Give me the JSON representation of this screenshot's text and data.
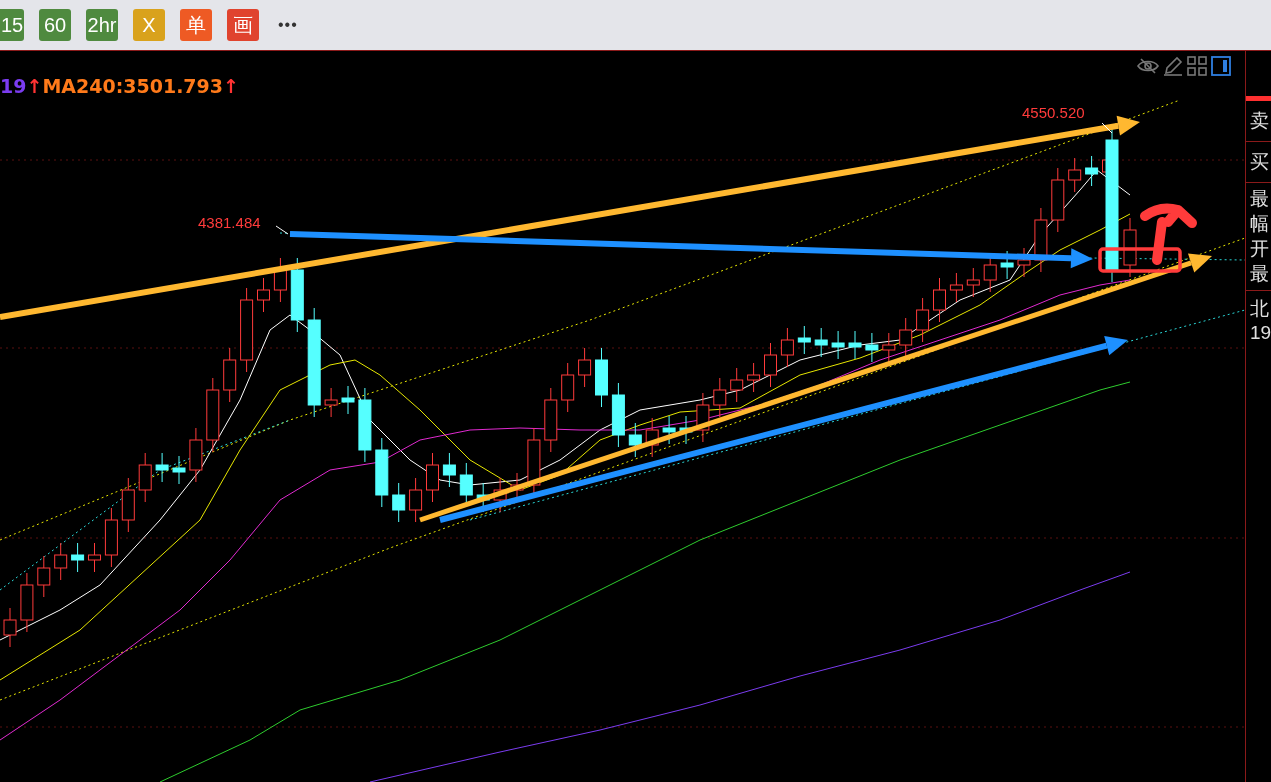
{
  "toolbar": {
    "buttons": [
      {
        "label": "15",
        "color": "#4f8a3f"
      },
      {
        "label": "60",
        "color": "#4f8a3f"
      },
      {
        "label": "2hr",
        "color": "#4f8a3f"
      },
      {
        "label": "X",
        "color": "#d9a21c"
      },
      {
        "label": "单",
        "color": "#ee5a24"
      },
      {
        "label": "画",
        "color": "#e0432e"
      }
    ],
    "more": "•••"
  },
  "legend": {
    "items": [
      {
        "text": "19",
        "color": "#7b3cf0"
      },
      {
        "text": "↑",
        "color": "#ff3333"
      },
      {
        "text": "MA240:3501.793",
        "color": "#ff7a1a"
      },
      {
        "text": "↑",
        "color": "#ff3333"
      }
    ]
  },
  "chart_tools": [
    {
      "kind": "hide",
      "selected": false
    },
    {
      "kind": "draw",
      "selected": false
    },
    {
      "kind": "grid",
      "selected": false
    },
    {
      "kind": "panel",
      "selected": true
    }
  ],
  "chart": {
    "price_labels": [
      "4381.484",
      "4550.520"
    ]
  },
  "side_panel": {
    "labels": [
      "卖",
      "买",
      "最",
      "幅",
      "开",
      "最",
      "北",
      "19"
    ]
  }
}
